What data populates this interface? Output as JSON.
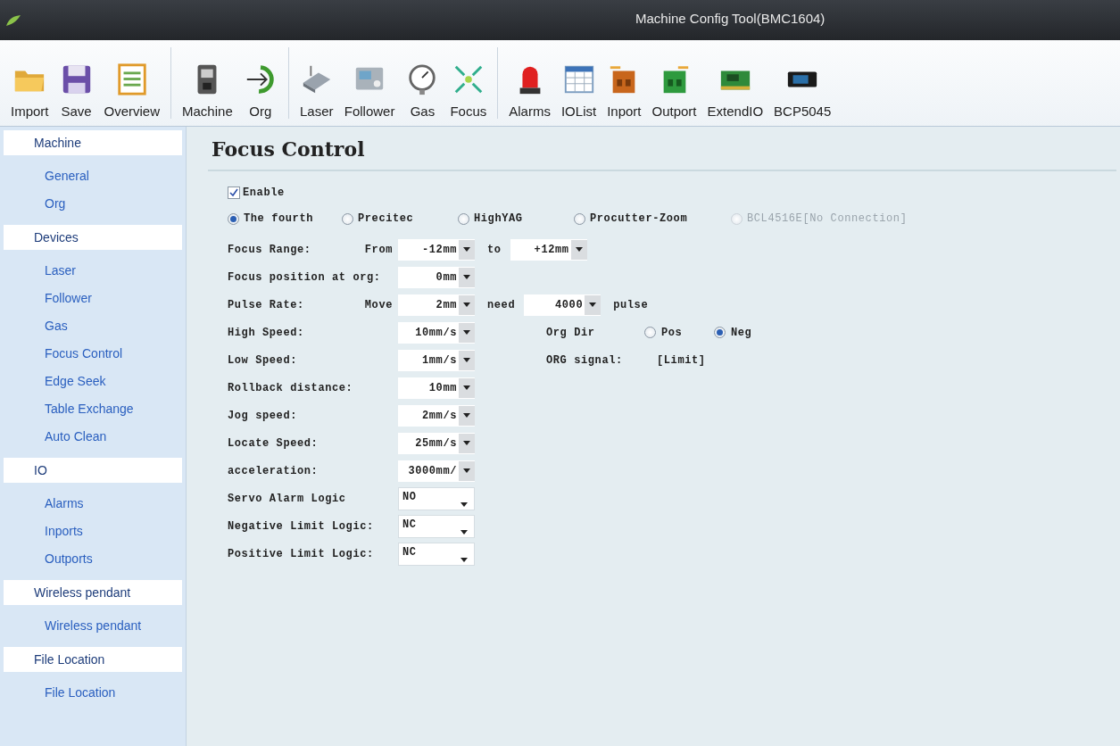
{
  "window": {
    "title": "Machine Config Tool(BMC1604)"
  },
  "toolbar": {
    "groups": [
      [
        "Import",
        "Save",
        "Overview"
      ],
      [
        "Machine",
        "Org"
      ],
      [
        "Laser",
        "Follower",
        "Gas",
        "Focus"
      ],
      [
        "Alarms",
        "IOList",
        "Inport",
        "Outport",
        "ExtendIO",
        "BCP5045"
      ]
    ]
  },
  "sidebar": {
    "sections": [
      {
        "header": "Machine",
        "items": [
          "General",
          "Org"
        ]
      },
      {
        "header": "Devices",
        "items": [
          "Laser",
          "Follower",
          "Gas",
          "Focus Control",
          "Edge Seek",
          "Table Exchange",
          "Auto Clean"
        ]
      },
      {
        "header": "IO",
        "items": [
          "Alarms",
          "Inports",
          "Outports"
        ]
      },
      {
        "header": "Wireless pendant",
        "items": [
          "Wireless pendant"
        ]
      },
      {
        "header": "File Location",
        "items": [
          "File Location"
        ]
      }
    ]
  },
  "panel": {
    "title": "Focus Control",
    "enable": {
      "label": "Enable",
      "checked": true
    },
    "heads": [
      {
        "label": "The fourth",
        "selected": true,
        "disabled": false
      },
      {
        "label": "Precitec",
        "selected": false,
        "disabled": false
      },
      {
        "label": "HighYAG",
        "selected": false,
        "disabled": false
      },
      {
        "label": "Procutter-Zoom",
        "selected": false,
        "disabled": false
      },
      {
        "label": "BCL4516E[No Connection]",
        "selected": false,
        "disabled": true
      }
    ],
    "rows": [
      {
        "label": "Focus Range:",
        "prefix": "From",
        "controls": [
          {
            "kind": "dropdown",
            "value": "-12mm"
          },
          {
            "kind": "text",
            "text": "to"
          },
          {
            "kind": "dropdown",
            "value": "+12mm"
          }
        ]
      },
      {
        "label": "Focus position at org:",
        "controls": [
          {
            "kind": "dropdown",
            "value": "0mm"
          }
        ]
      },
      {
        "label": "Pulse Rate:",
        "prefix": "Move",
        "controls": [
          {
            "kind": "dropdown",
            "value": "2mm"
          },
          {
            "kind": "text",
            "text": "need"
          },
          {
            "kind": "dropdown",
            "value": "4000"
          },
          {
            "kind": "text",
            "text": "pulse"
          }
        ]
      },
      {
        "label": "High Speed:",
        "controls": [
          {
            "kind": "dropdown",
            "value": "10mm/s"
          },
          {
            "kind": "caption",
            "text": "Org Dir"
          },
          {
            "kind": "radio",
            "label": "Pos",
            "selected": false
          },
          {
            "kind": "radio",
            "label": "Neg",
            "selected": true
          }
        ]
      },
      {
        "label": "Low Speed:",
        "controls": [
          {
            "kind": "dropdown",
            "value": "1mm/s"
          },
          {
            "kind": "caption",
            "text": "ORG signal:"
          },
          {
            "kind": "text",
            "text": "[Limit]"
          }
        ]
      },
      {
        "label": "Rollback distance:",
        "controls": [
          {
            "kind": "dropdown",
            "value": "10mm"
          }
        ]
      },
      {
        "label": "Jog speed:",
        "controls": [
          {
            "kind": "dropdown",
            "value": "2mm/s"
          }
        ]
      },
      {
        "label": "Locate Speed:",
        "controls": [
          {
            "kind": "dropdown",
            "value": "25mm/s"
          }
        ]
      },
      {
        "label": "acceleration:",
        "controls": [
          {
            "kind": "dropdown",
            "value": "3000mm/"
          }
        ]
      },
      {
        "label": "Servo Alarm Logic",
        "controls": [
          {
            "kind": "combo",
            "value": "NO"
          }
        ]
      },
      {
        "label": "Negative Limit Logic:",
        "controls": [
          {
            "kind": "combo",
            "value": "NC"
          }
        ]
      },
      {
        "label": "Positive Limit Logic:",
        "controls": [
          {
            "kind": "combo",
            "value": "NC"
          }
        ]
      }
    ]
  }
}
